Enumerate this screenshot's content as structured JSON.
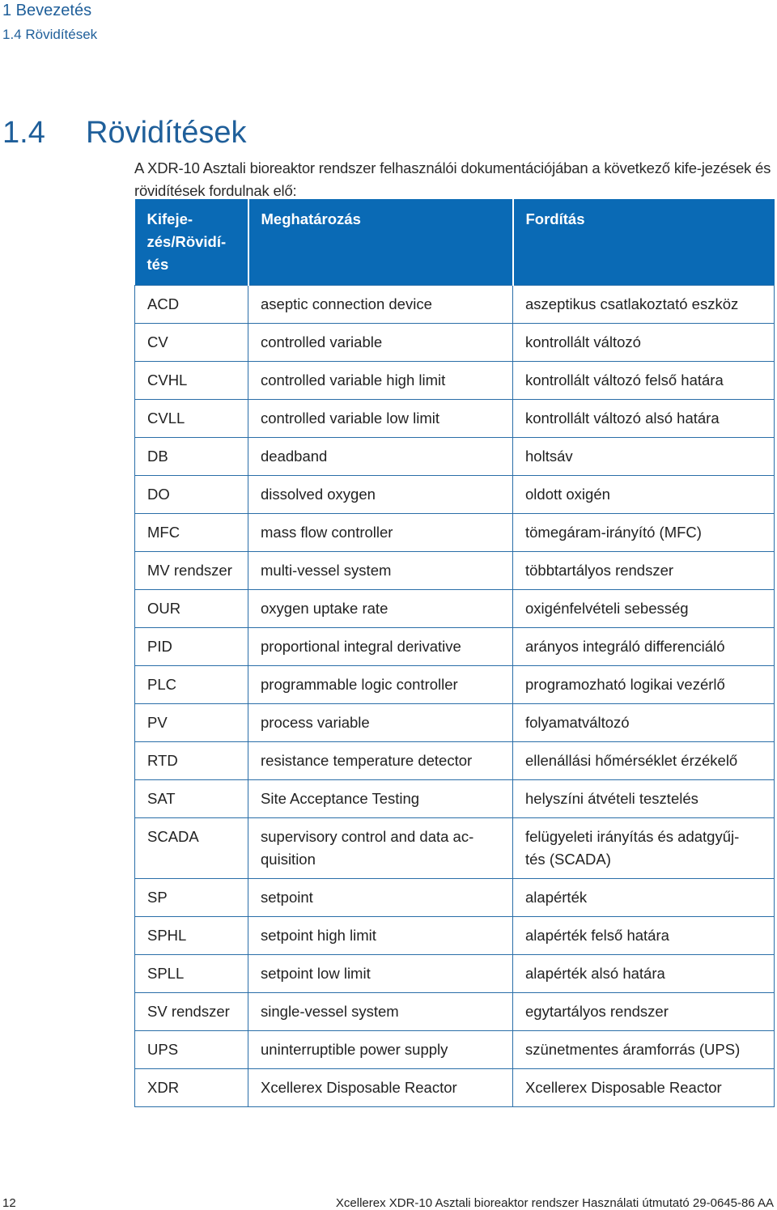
{
  "running_head": {
    "chapter": "1  Bevezetés",
    "section": "1.4  Rövidítések"
  },
  "section": {
    "number": "1.4",
    "title": "Rövidítések",
    "intro": "A XDR-10 Asztali bioreaktor rendszer felhasználói dokumentációjában a következő kife-jezések és rövidítések fordulnak elő:"
  },
  "table": {
    "headers": [
      "Kifeje-zés/Rövidí-tés",
      "Meghatározás",
      "Fordítás"
    ],
    "rows": [
      {
        "abbr": "ACD",
        "definition": "aseptic connection device",
        "translation": "aszeptikus csatlakoztató eszköz"
      },
      {
        "abbr": "CV",
        "definition": "controlled variable",
        "translation": "kontrollált változó"
      },
      {
        "abbr": "CVHL",
        "definition": "controlled variable high limit",
        "translation": "kontrollált változó felső határa"
      },
      {
        "abbr": "CVLL",
        "definition": "controlled variable low limit",
        "translation": "kontrollált változó alsó határa"
      },
      {
        "abbr": "DB",
        "definition": "deadband",
        "translation": "holtsáv"
      },
      {
        "abbr": "DO",
        "definition": "dissolved oxygen",
        "translation": "oldott oxigén"
      },
      {
        "abbr": "MFC",
        "definition": "mass flow controller",
        "translation": "tömegáram-irányító (MFC)"
      },
      {
        "abbr": "MV rendszer",
        "definition": "multi-vessel system",
        "translation": "többtartályos rendszer"
      },
      {
        "abbr": "OUR",
        "definition": "oxygen uptake rate",
        "translation": "oxigénfelvételi sebesség"
      },
      {
        "abbr": "PID",
        "definition": "proportional integral derivative",
        "translation": "arányos integráló differenciáló"
      },
      {
        "abbr": "PLC",
        "definition": "programmable logic controller",
        "translation": "programozható logikai vezérlő"
      },
      {
        "abbr": "PV",
        "definition": "process variable",
        "translation": "folyamatváltozó"
      },
      {
        "abbr": "RTD",
        "definition": "resistance temperature detector",
        "translation": "ellenállási hőmérséklet érzékelő"
      },
      {
        "abbr": "SAT",
        "definition": "Site Acceptance Testing",
        "translation": "helyszíni átvételi tesztelés"
      },
      {
        "abbr": "SCADA",
        "definition": "supervisory control and data ac-quisition",
        "translation": "felügyeleti irányítás és adatgyűj-tés (SCADA)"
      },
      {
        "abbr": "SP",
        "definition": "setpoint",
        "translation": "alapérték"
      },
      {
        "abbr": "SPHL",
        "definition": "setpoint high limit",
        "translation": "alapérték felső határa"
      },
      {
        "abbr": "SPLL",
        "definition": "setpoint low limit",
        "translation": "alapérték alsó határa"
      },
      {
        "abbr": "SV rendszer",
        "definition": "single-vessel system",
        "translation": "egytartályos rendszer"
      },
      {
        "abbr": "UPS",
        "definition": "uninterruptible power supply",
        "translation": "szünetmentes áramforrás (UPS)"
      },
      {
        "abbr": "XDR",
        "definition": "Xcellerex Disposable Reactor",
        "translation": "Xcellerex Disposable Reactor"
      }
    ]
  },
  "footer": {
    "page_number": "12",
    "document_title": "Xcellerex XDR-10 Asztali bioreaktor rendszer Használati útmutató 29-0645-86 AA"
  }
}
